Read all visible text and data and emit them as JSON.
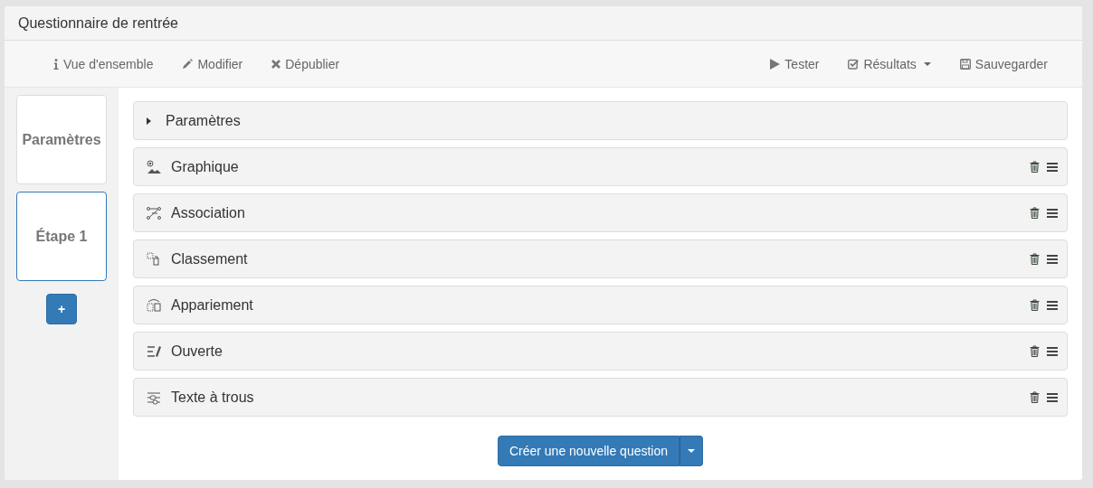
{
  "window": {
    "title": "Questionnaire de rentrée"
  },
  "toolbar": {
    "left": [
      {
        "kind": "info",
        "label": "Vue d'ensemble"
      },
      {
        "kind": "pencil",
        "label": "Modifier"
      },
      {
        "kind": "cross",
        "label": "Dépublier"
      }
    ],
    "right": [
      {
        "kind": "play",
        "label": "Tester",
        "dropdown": false
      },
      {
        "kind": "check",
        "label": "Résultats",
        "dropdown": true
      },
      {
        "kind": "save",
        "label": "Sauvegarder",
        "dropdown": false
      }
    ]
  },
  "sidebar": {
    "steps": [
      {
        "label": "Paramètres",
        "selected": false
      },
      {
        "label": "Étape 1",
        "selected": true
      }
    ],
    "add_button": "+"
  },
  "settings_row": {
    "label": "Paramètres",
    "expanded": false
  },
  "questions": [
    {
      "kind": "graphic",
      "label": "Graphique"
    },
    {
      "kind": "association",
      "label": "Association"
    },
    {
      "kind": "ordering",
      "label": "Classement"
    },
    {
      "kind": "pairing",
      "label": "Appariement"
    },
    {
      "kind": "open",
      "label": "Ouverte"
    },
    {
      "kind": "cloze",
      "label": "Texte à trous"
    }
  ],
  "create_button": {
    "label": "Créer une nouvelle question"
  }
}
